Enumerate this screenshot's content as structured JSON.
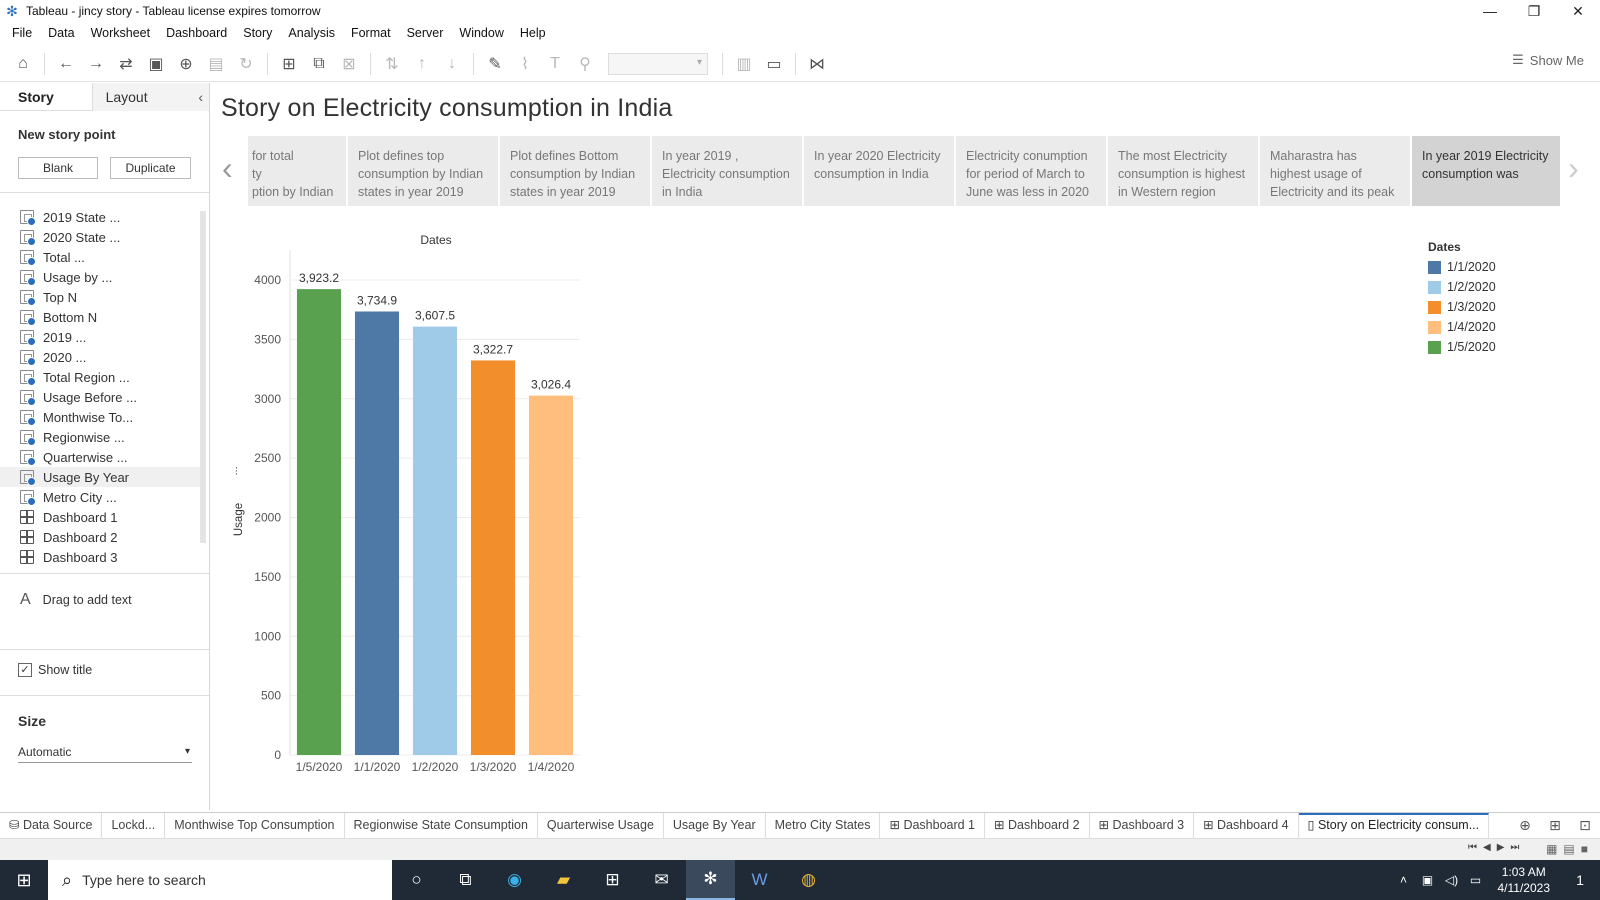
{
  "window": {
    "title": "Tableau - jincy story - Tableau license expires tomorrow",
    "controls": [
      "—",
      "❐",
      "✕"
    ]
  },
  "menu": [
    "File",
    "Data",
    "Worksheet",
    "Dashboard",
    "Story",
    "Analysis",
    "Format",
    "Server",
    "Window",
    "Help"
  ],
  "toolbar": {
    "show_me_label": "Show Me"
  },
  "left_pane": {
    "tabs": [
      "Story",
      "Layout"
    ],
    "new_story_point_label": "New story point",
    "blank_label": "Blank",
    "duplicate_label": "Duplicate",
    "sheets": [
      {
        "label": "2019 State ...",
        "kind": "worksheet"
      },
      {
        "label": "2020 State  ...",
        "kind": "worksheet"
      },
      {
        "label": "Total ...",
        "kind": "worksheet"
      },
      {
        "label": "Usage by ...",
        "kind": "worksheet"
      },
      {
        "label": "Top N",
        "kind": "worksheet"
      },
      {
        "label": "Bottom N",
        "kind": "worksheet"
      },
      {
        "label": "2019 ...",
        "kind": "worksheet"
      },
      {
        "label": "2020 ...",
        "kind": "worksheet"
      },
      {
        "label": "Total Region ...",
        "kind": "worksheet"
      },
      {
        "label": "Usage Before ...",
        "kind": "worksheet"
      },
      {
        "label": "Monthwise To...",
        "kind": "worksheet"
      },
      {
        "label": "Regionwise ...",
        "kind": "worksheet"
      },
      {
        "label": "Quarterwise ...",
        "kind": "worksheet"
      },
      {
        "label": "Usage By Year",
        "kind": "worksheet",
        "highlighted": true
      },
      {
        "label": "Metro City ...",
        "kind": "worksheet"
      },
      {
        "label": "Dashboard 1",
        "kind": "dashboard"
      },
      {
        "label": "Dashboard 2",
        "kind": "dashboard"
      },
      {
        "label": "Dashboard 3",
        "kind": "dashboard"
      }
    ],
    "drag_text_label": "Drag to add text",
    "show_title_label": "Show title",
    "show_title_checked": true,
    "size_label": "Size",
    "size_value": "Automatic"
  },
  "story": {
    "title": "Story on Electricity consumption in India",
    "story_points": [
      {
        "text": "for total\nty\nption by Indian",
        "cut": true
      },
      {
        "text": "Plot defines top consumption by Indian states in year 2019"
      },
      {
        "text": "Plot defines Bottom consumption by Indian states in year 2019"
      },
      {
        "text": "In year 2019 , Electricity consumption in India"
      },
      {
        "text": "In year 2020 Electricity consumption in India"
      },
      {
        "text": "Electricity conumption for period of March to June was less in 2020"
      },
      {
        "text": "The most Electricity consumption is highest in Western region"
      },
      {
        "text": "Maharastra has highest usage of Electricity and its peak"
      },
      {
        "text": "In year 2019 Electricity consumption was",
        "active": true
      }
    ]
  },
  "chart_data": {
    "type": "bar",
    "title": "Dates",
    "categories": [
      "1/5/2020",
      "1/1/2020",
      "1/2/2020",
      "1/3/2020",
      "1/4/2020"
    ],
    "values": [
      3923.2,
      3734.9,
      3607.5,
      3322.7,
      3026.4
    ],
    "value_labels": [
      "3,923.2",
      "3,734.9",
      "3,607.5",
      "3,322.7",
      "3,026.4"
    ],
    "colors": [
      "#59a14f",
      "#4e79a7",
      "#a0cbe8",
      "#f28e2b",
      "#ffbe7d"
    ],
    "ylabel": "Usage",
    "xlabel": "",
    "ylim": [
      0,
      4000
    ],
    "yticks": [
      0,
      500,
      1000,
      1500,
      2000,
      2500,
      3000,
      3500,
      4000
    ],
    "grid": true,
    "legend": {
      "title": "Dates",
      "position": "right",
      "entries": [
        {
          "label": "1/1/2020",
          "color": "#4e79a7"
        },
        {
          "label": "1/2/2020",
          "color": "#a0cbe8"
        },
        {
          "label": "1/3/2020",
          "color": "#f28e2b"
        },
        {
          "label": "1/4/2020",
          "color": "#ffbe7d"
        },
        {
          "label": "1/5/2020",
          "color": "#59a14f"
        }
      ]
    }
  },
  "sheet_tabs": [
    {
      "label": "Data Source",
      "icon": "database-icon"
    },
    {
      "label": "Lockd...",
      "icon": ""
    },
    {
      "label": "Monthwise Top Consumption",
      "icon": ""
    },
    {
      "label": "Regionwise State Consumption",
      "icon": ""
    },
    {
      "label": "Quarterwise Usage",
      "icon": ""
    },
    {
      "label": "Usage By Year",
      "icon": ""
    },
    {
      "label": "Metro City States",
      "icon": ""
    },
    {
      "label": "Dashboard 1",
      "icon": "dashboard-icon"
    },
    {
      "label": "Dashboard 2",
      "icon": "dashboard-icon"
    },
    {
      "label": "Dashboard 3",
      "icon": "dashboard-icon"
    },
    {
      "label": "Dashboard 4",
      "icon": "dashboard-icon"
    },
    {
      "label": "Story on Electricity consum...",
      "icon": "story-icon",
      "active": true
    }
  ],
  "taskbar": {
    "search_placeholder": "Type here to search",
    "time": "1:03 AM",
    "date": "4/11/2023",
    "notification_count": "1"
  }
}
